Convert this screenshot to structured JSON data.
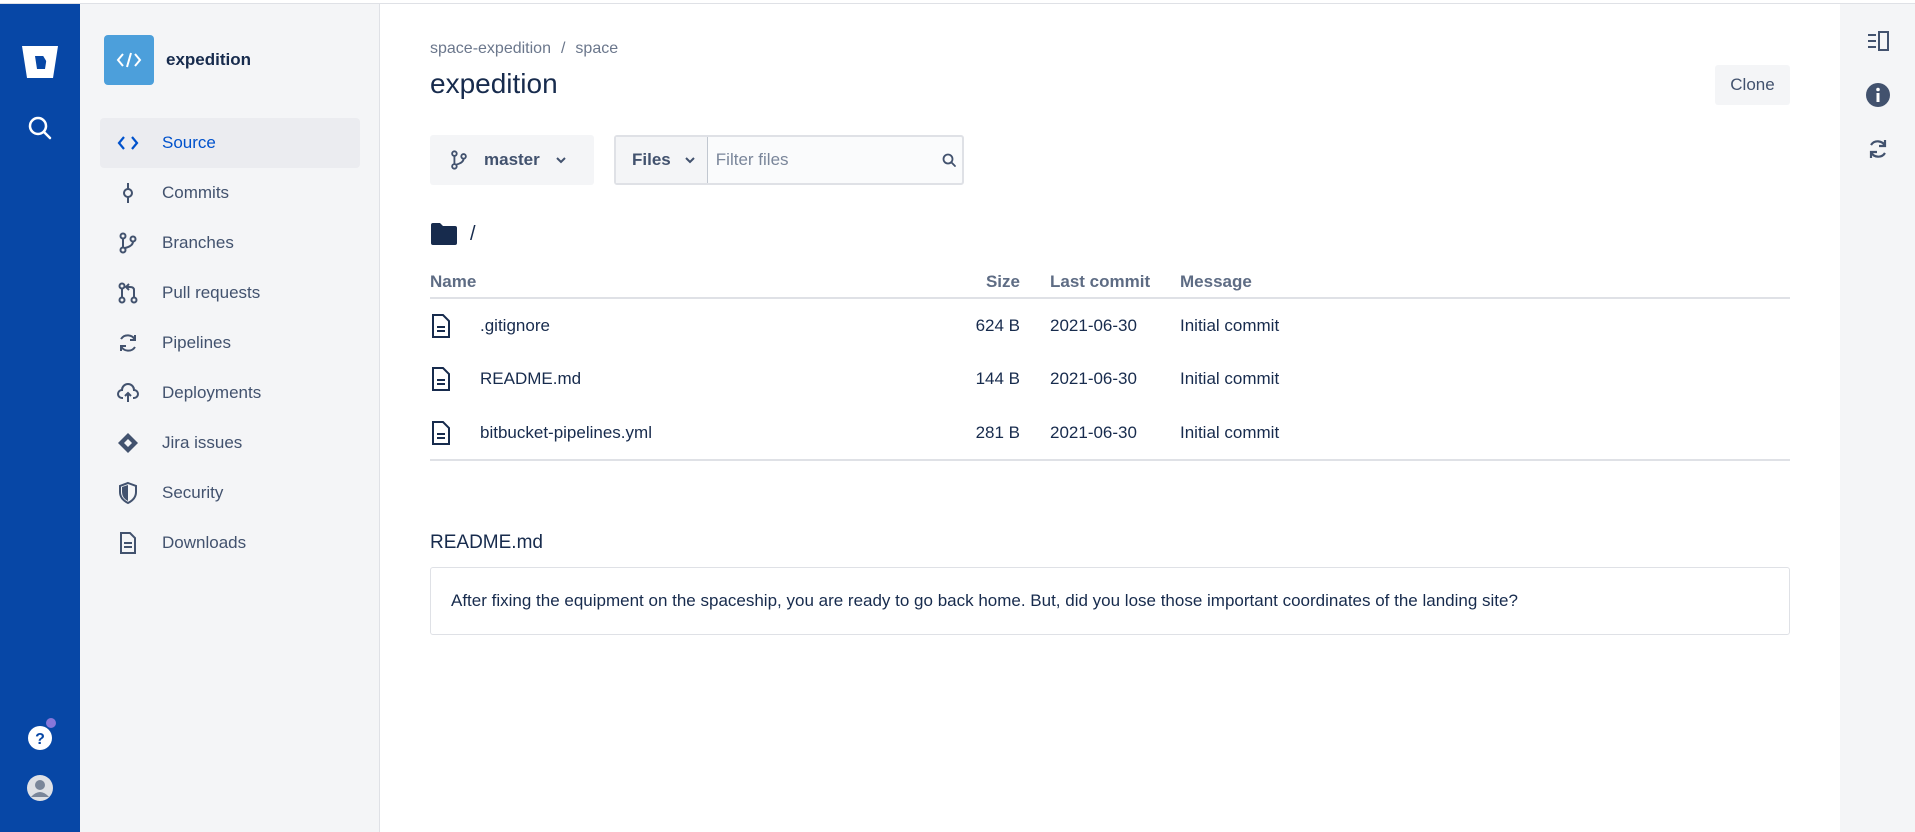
{
  "global_nav": {
    "logo_icon": "bitbucket-logo-icon",
    "search_icon": "search-icon",
    "help_icon": "help-icon",
    "avatar_icon": "user-avatar-icon"
  },
  "repo": {
    "name": "expedition",
    "avatar_icon": "code-icon"
  },
  "sidebar": {
    "items": [
      {
        "label": "Source",
        "icon": "code-icon",
        "active": true
      },
      {
        "label": "Commits",
        "icon": "commit-icon"
      },
      {
        "label": "Branches",
        "icon": "branch-icon"
      },
      {
        "label": "Pull requests",
        "icon": "pull-request-icon"
      },
      {
        "label": "Pipelines",
        "icon": "refresh-icon"
      },
      {
        "label": "Deployments",
        "icon": "cloud-upload-icon"
      },
      {
        "label": "Jira issues",
        "icon": "jira-icon"
      },
      {
        "label": "Security",
        "icon": "shield-icon"
      },
      {
        "label": "Downloads",
        "icon": "document-icon"
      }
    ]
  },
  "header": {
    "breadcrumb": [
      "space-expedition",
      "space"
    ],
    "breadcrumb_sep": "/",
    "title": "expedition",
    "clone_label": "Clone"
  },
  "toolbar": {
    "branch": "master",
    "files_label": "Files",
    "filter_placeholder": "Filter files"
  },
  "path": "/",
  "file_table": {
    "columns": [
      "Name",
      "Size",
      "Last commit",
      "Message"
    ],
    "rows": [
      {
        "name": ".gitignore",
        "size": "624 B",
        "last_commit": "2021-06-30",
        "message": "Initial commit"
      },
      {
        "name": "README.md",
        "size": "144 B",
        "last_commit": "2021-06-30",
        "message": "Initial commit"
      },
      {
        "name": "bitbucket-pipelines.yml",
        "size": "281 B",
        "last_commit": "2021-06-30",
        "message": "Initial commit"
      }
    ]
  },
  "readme": {
    "title": "README.md",
    "content": "After fixing the equipment on the spaceship, you are ready to go back home. But, did you lose those important coordinates of the landing site?"
  },
  "right_rail": {
    "icons": [
      "sidebar-toggle-icon",
      "info-icon",
      "sync-icon"
    ]
  },
  "colors": {
    "global_nav_bg": "#0747a6",
    "active_link": "#0052cc",
    "text": "#172b4d"
  }
}
